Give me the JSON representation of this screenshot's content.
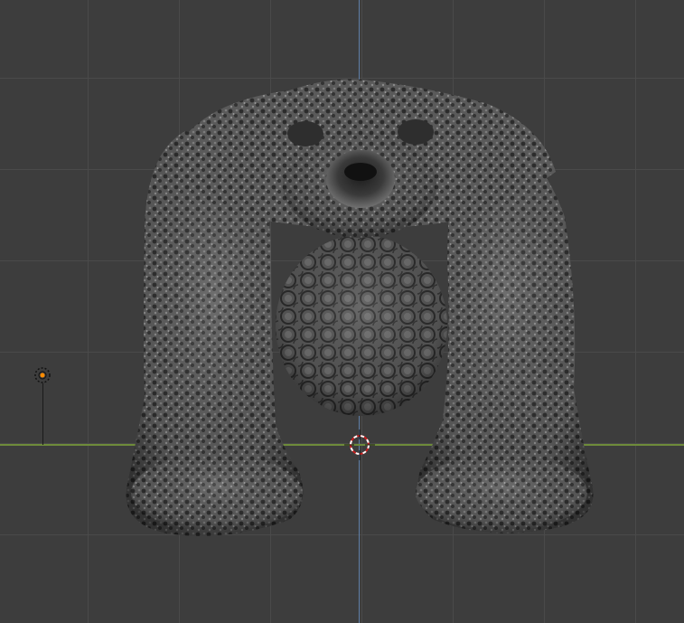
{
  "viewport": {
    "grid_color": "#4a4a4a",
    "background_color": "#3d3d3d",
    "axis_x_color": "#6e8b3a",
    "axis_z_color": "#5f7fa8"
  },
  "scene": {
    "objects": [
      {
        "name": "sculpted-bear-creature",
        "type": "mesh"
      },
      {
        "name": "point-light",
        "type": "light",
        "icon": "light-icon",
        "color": "#ff8c00"
      },
      {
        "name": "3d-cursor",
        "type": "cursor",
        "icon": "3d-cursor-icon",
        "color": "#c81e1e"
      }
    ]
  }
}
